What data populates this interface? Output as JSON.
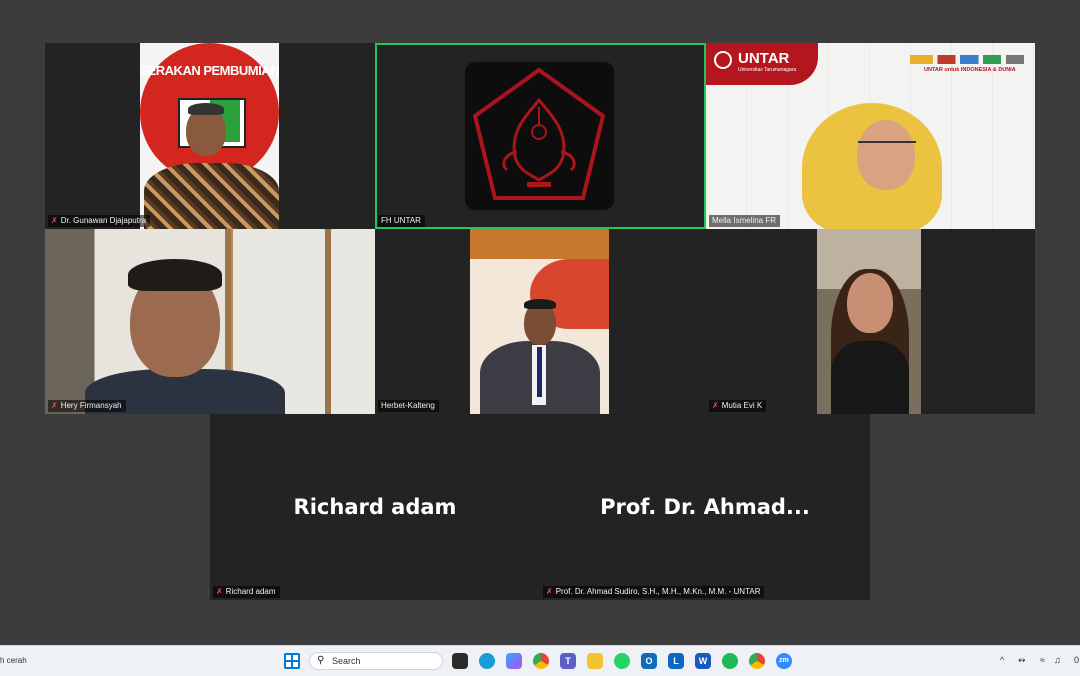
{
  "participants": [
    {
      "name_tag": "Dr. Gunawan Djajaputra",
      "muted": true
    },
    {
      "name_tag": "FH UNTAR",
      "muted": false,
      "active_speaker": true
    },
    {
      "name_tag": "Mella Ismelina FR",
      "muted": false
    },
    {
      "name_tag": "Hery Firmansyah",
      "muted": true
    },
    {
      "name_tag": "Herbet-Kalteng",
      "muted": false
    },
    {
      "name_tag": "Mutia Evi K",
      "muted": true
    },
    {
      "name_tag": "Richard adam",
      "muted": true,
      "display_name": "Richard adam"
    },
    {
      "name_tag": "Prof. Dr. Ahmad Sudiro, S.H., M.H., M.Kn., M.M. - UNTAR",
      "muted": true,
      "display_name": "Prof. Dr. Ahmad..."
    }
  ],
  "backgrounds": {
    "banner_text": "GERAKAN PEMBUMIAN PANCASILA",
    "untar_logo_text": "UNTAR",
    "untar_sub": "Universitas Tarumanagara",
    "untar_slogan": "UNTAR untuk INDONESIA & DUNIA"
  },
  "taskbar": {
    "weather": "h cerah",
    "search_placeholder": "Search",
    "icons": [
      "windows-start",
      "widgets",
      "edge",
      "copilot",
      "chrome",
      "teams",
      "file-explorer",
      "whatsapp",
      "outlook",
      "linkedin",
      "word",
      "spotify",
      "chrome-alt",
      "zoom"
    ],
    "tray_chevron": "^",
    "time_fragment": "0"
  },
  "colors": {
    "active_border": "#22c55e",
    "tile_bg": "#232323",
    "stage_bg": "#3c3c3c",
    "untar_red": "#b3161d",
    "mute_red": "#ff4d4d"
  }
}
